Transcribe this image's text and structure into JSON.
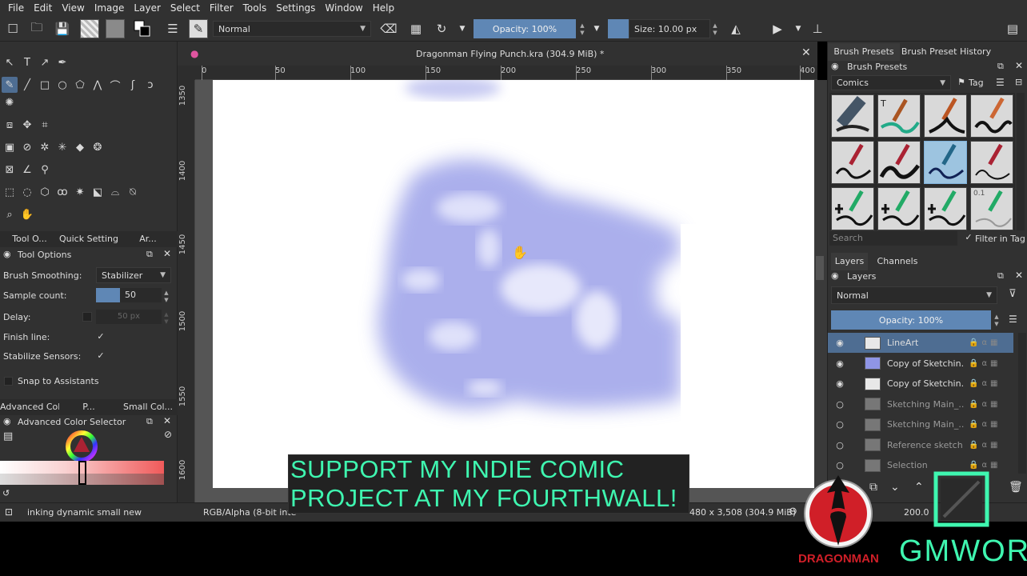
{
  "menu": [
    "File",
    "Edit",
    "View",
    "Image",
    "Layer",
    "Select",
    "Filter",
    "Tools",
    "Settings",
    "Window",
    "Help"
  ],
  "toolbar": {
    "blend_mode": "Normal",
    "opacity_label": "Opacity: 100%",
    "size_label": "Size: 10.00 px"
  },
  "document": {
    "title": "Dragonman Flying Punch.kra (304.9 MiB) *"
  },
  "ruler_h": [
    "0",
    "50",
    "100",
    "150",
    "200",
    "250",
    "300",
    "350",
    "400"
  ],
  "ruler_v": [
    "1350",
    "1400",
    "1450",
    "1500",
    "1550",
    "1600"
  ],
  "left": {
    "tabs": [
      "Tool O...",
      "Quick Settings ...",
      "Ar..."
    ],
    "tool_options_title": "Tool Options",
    "brush_smoothing_label": "Brush Smoothing:",
    "brush_smoothing_value": "Stabilizer",
    "sample_count_label": "Sample count:",
    "sample_count_value": "50",
    "delay_label": "Delay:",
    "delay_value": "50 px",
    "finish_line_label": "Finish line:",
    "stabilize_sensors_label": "Stabilize Sensors:",
    "snap_label": "Snap to Assistants",
    "color_tabs": [
      "Advanced Col...",
      "P...",
      "Small Col..."
    ],
    "color_selector_title": "Advanced Color Selector"
  },
  "right": {
    "tabs": [
      "Brush Presets",
      "Brush Preset History"
    ],
    "presets_title": "Brush Presets",
    "preset_category": "Comics",
    "tag_label": "Tag",
    "search_placeholder": "Search",
    "filter_in_tag_label": "Filter in Tag",
    "preset_label_small": "0.1",
    "layer_tabs": [
      "Layers",
      "Channels"
    ],
    "layers_title": "Layers",
    "layer_blend": "Normal",
    "layer_opacity": "Opacity:  100%",
    "layers": [
      {
        "name": "LineArt",
        "visible": true,
        "active": true
      },
      {
        "name": "Copy of Sketchin...",
        "visible": true,
        "active": false
      },
      {
        "name": "Copy of Sketchin...",
        "visible": true,
        "active": false
      },
      {
        "name": "Sketching Main_...",
        "visible": false,
        "active": false
      },
      {
        "name": "Sketching Main_...",
        "visible": false,
        "active": false
      },
      {
        "name": "Reference sketch",
        "visible": false,
        "active": false
      },
      {
        "name": "Selection",
        "visible": false,
        "active": false
      }
    ]
  },
  "status": {
    "brush_name": "inking dynamic small new",
    "color_space": "RGB/Alpha (8-bit inte",
    "dimensions": "480 x 3,508 (304.9 MiB)",
    "zoom": "200.0"
  },
  "overlay": {
    "banner_line1": "SUPPORT MY INDIE COMIC",
    "banner_line2": "PROJECT AT MY FOURTHWALL!",
    "logo_left_text": "DRAGONMAN",
    "logo_right_text": "GMWOR"
  },
  "colors": {
    "accent": "#5f87b5",
    "banner_text": "#3ff6b0",
    "sketch": "#8f95e6",
    "logo_red": "#d01f28"
  }
}
